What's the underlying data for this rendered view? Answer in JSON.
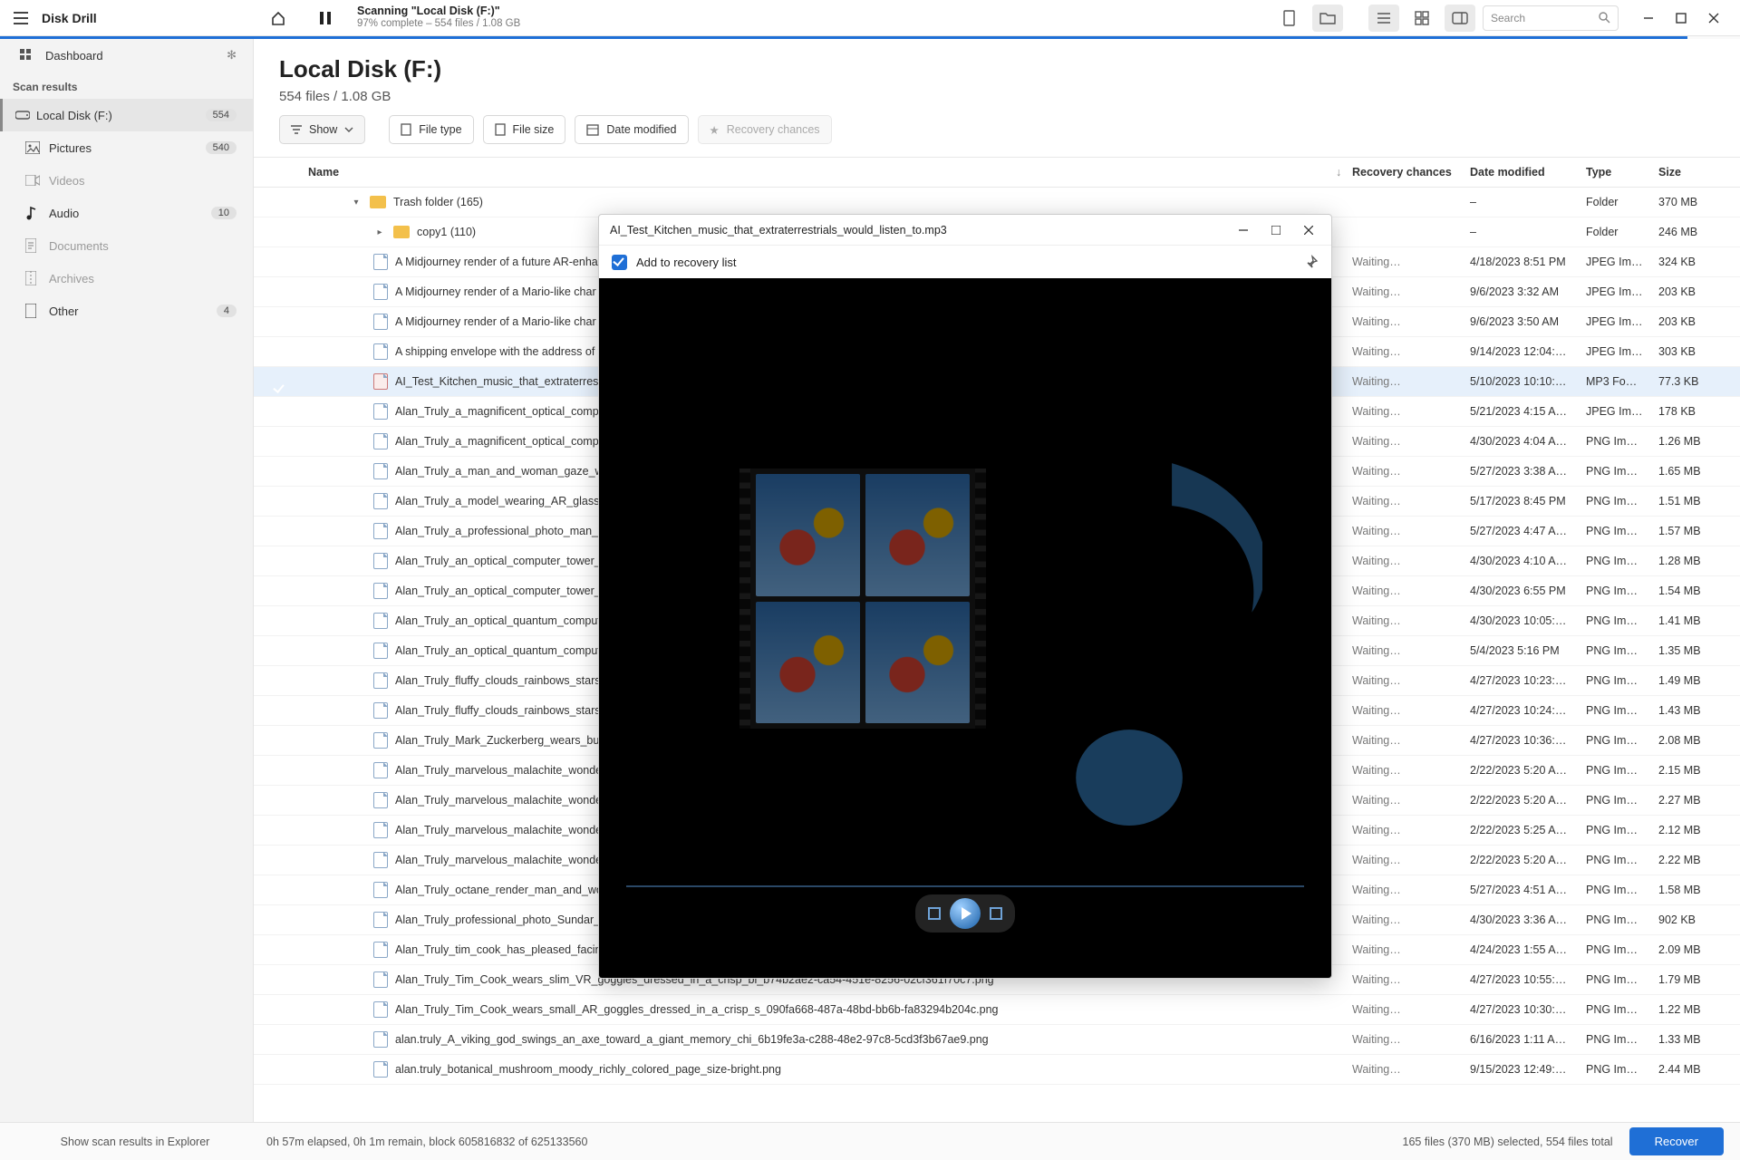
{
  "app": {
    "title": "Disk Drill"
  },
  "scan_status": {
    "line1": "Scanning \"Local Disk (F:)\"",
    "line2": "97% complete – 554 files / 1.08 GB",
    "progress_pct": 97
  },
  "search": {
    "placeholder": "Search"
  },
  "sidebar": {
    "dashboard": "Dashboard",
    "section": "Scan results",
    "items": [
      {
        "icon": "disk",
        "label": "Local Disk (F:)",
        "badge": "554",
        "active": true
      },
      {
        "icon": "picture",
        "label": "Pictures",
        "badge": "540",
        "indent": true
      },
      {
        "icon": "video",
        "label": "Videos",
        "disabled": true,
        "indent": true
      },
      {
        "icon": "audio",
        "label": "Audio",
        "badge": "10",
        "indent": true
      },
      {
        "icon": "doc",
        "label": "Documents",
        "disabled": true,
        "indent": true
      },
      {
        "icon": "archive",
        "label": "Archives",
        "disabled": true,
        "indent": true
      },
      {
        "icon": "other",
        "label": "Other",
        "badge": "4",
        "indent": true
      }
    ]
  },
  "header": {
    "title": "Local Disk (F:)",
    "subtitle": "554 files / 1.08 GB"
  },
  "toolbar": {
    "show": "Show",
    "filetype": "File type",
    "filesize": "File size",
    "datemod": "Date modified",
    "recchance": "Recovery chances"
  },
  "columns": {
    "name": "Name",
    "rec": "Recovery chances",
    "date": "Date modified",
    "type": "Type",
    "size": "Size"
  },
  "rows": [
    {
      "kind": "folder",
      "depth": 1,
      "exp": "▾",
      "name": "Trash folder (165)",
      "rec": "",
      "date": "–",
      "type": "Folder",
      "size": "370 MB"
    },
    {
      "kind": "folder",
      "depth": 2,
      "exp": "▸",
      "name": "copy1 (110)",
      "rec": "",
      "date": "–",
      "type": "Folder",
      "size": "246 MB"
    },
    {
      "kind": "file",
      "depth": 2,
      "name": "A Midjourney render of a future AR-enha",
      "rec": "Waiting…",
      "date": "4/18/2023 8:51 PM",
      "type": "JPEG Im…",
      "size": "324 KB"
    },
    {
      "kind": "file",
      "depth": 2,
      "name": "A Midjourney render of a Mario-like char",
      "rec": "Waiting…",
      "date": "9/6/2023 3:32 AM",
      "type": "JPEG Im…",
      "size": "203 KB"
    },
    {
      "kind": "file",
      "depth": 2,
      "name": "A Midjourney render of a Mario-like char",
      "rec": "Waiting…",
      "date": "9/6/2023 3:50 AM",
      "type": "JPEG Im…",
      "size": "203 KB"
    },
    {
      "kind": "file",
      "depth": 2,
      "name": "A shipping envelope with the address of t",
      "rec": "Waiting…",
      "date": "9/14/2023 12:04:…",
      "type": "JPEG Im…",
      "size": "303 KB"
    },
    {
      "kind": "audio",
      "depth": 2,
      "sel": true,
      "name": "AI_Test_Kitchen_music_that_extraterrestria",
      "rec": "Waiting…",
      "date": "5/10/2023 10:10:…",
      "type": "MP3 Fo…",
      "size": "77.3 KB"
    },
    {
      "kind": "file",
      "depth": 2,
      "name": "Alan_Truly_a_magnificent_optical_comput",
      "rec": "Waiting…",
      "date": "5/21/2023 4:15 A…",
      "type": "JPEG Im…",
      "size": "178 KB"
    },
    {
      "kind": "file",
      "depth": 2,
      "name": "Alan_Truly_a_magnificent_optical_comput",
      "rec": "Waiting…",
      "date": "4/30/2023 4:04 A…",
      "type": "PNG Im…",
      "size": "1.26 MB"
    },
    {
      "kind": "file",
      "depth": 2,
      "name": "Alan_Truly_a_man_and_woman_gaze_with",
      "rec": "Waiting…",
      "date": "5/27/2023 3:38 A…",
      "type": "PNG Im…",
      "size": "1.65 MB"
    },
    {
      "kind": "file",
      "depth": 2,
      "name": "Alan_Truly_a_model_wearing_AR_glasses_",
      "rec": "Waiting…",
      "date": "5/17/2023 8:45 PM",
      "type": "PNG Im…",
      "size": "1.51 MB"
    },
    {
      "kind": "file",
      "depth": 2,
      "name": "Alan_Truly_a_professional_photo_man_an",
      "rec": "Waiting…",
      "date": "5/27/2023 4:47 A…",
      "type": "PNG Im…",
      "size": "1.57 MB"
    },
    {
      "kind": "file",
      "depth": 2,
      "name": "Alan_Truly_an_optical_computer_tower_lig",
      "rec": "Waiting…",
      "date": "4/30/2023 4:10 A…",
      "type": "PNG Im…",
      "size": "1.28 MB"
    },
    {
      "kind": "file",
      "depth": 2,
      "name": "Alan_Truly_an_optical_computer_tower_lig",
      "rec": "Waiting…",
      "date": "4/30/2023 6:55 PM",
      "type": "PNG Im…",
      "size": "1.54 MB"
    },
    {
      "kind": "file",
      "depth": 2,
      "name": "Alan_Truly_an_optical_quantum_computer",
      "rec": "Waiting…",
      "date": "4/30/2023 10:05:…",
      "type": "PNG Im…",
      "size": "1.41 MB"
    },
    {
      "kind": "file",
      "depth": 2,
      "name": "Alan_Truly_an_optical_quantum_computer",
      "rec": "Waiting…",
      "date": "5/4/2023 5:16 PM",
      "type": "PNG Im…",
      "size": "1.35 MB"
    },
    {
      "kind": "file",
      "depth": 2,
      "name": "Alan_Truly_fluffy_clouds_rainbows_stars_m",
      "rec": "Waiting…",
      "date": "4/27/2023 10:23:…",
      "type": "PNG Im…",
      "size": "1.49 MB"
    },
    {
      "kind": "file",
      "depth": 2,
      "name": "Alan_Truly_fluffy_clouds_rainbows_stars_m",
      "rec": "Waiting…",
      "date": "4/27/2023 10:24:…",
      "type": "PNG Im…",
      "size": "1.43 MB"
    },
    {
      "kind": "file",
      "depth": 2,
      "name": "Alan_Truly_Mark_Zuckerberg_wears_bulky",
      "rec": "Waiting…",
      "date": "4/27/2023 10:36:…",
      "type": "PNG Im…",
      "size": "2.08 MB"
    },
    {
      "kind": "file",
      "depth": 2,
      "name": "Alan_Truly_marvelous_malachite_wonder_",
      "rec": "Waiting…",
      "date": "2/22/2023 5:20 A…",
      "type": "PNG Im…",
      "size": "2.15 MB"
    },
    {
      "kind": "file",
      "depth": 2,
      "name": "Alan_Truly_marvelous_malachite_wonder_",
      "rec": "Waiting…",
      "date": "2/22/2023 5:20 A…",
      "type": "PNG Im…",
      "size": "2.27 MB"
    },
    {
      "kind": "file",
      "depth": 2,
      "name": "Alan_Truly_marvelous_malachite_wonder_",
      "rec": "Waiting…",
      "date": "2/22/2023 5:25 A…",
      "type": "PNG Im…",
      "size": "2.12 MB"
    },
    {
      "kind": "file",
      "depth": 2,
      "name": "Alan_Truly_marvelous_malachite_wonder_",
      "rec": "Waiting…",
      "date": "2/22/2023 5:20 A…",
      "type": "PNG Im…",
      "size": "2.22 MB"
    },
    {
      "kind": "file",
      "depth": 2,
      "name": "Alan_Truly_octane_render_man_and_wom",
      "rec": "Waiting…",
      "date": "5/27/2023 4:51 A…",
      "type": "PNG Im…",
      "size": "1.58 MB"
    },
    {
      "kind": "file",
      "depth": 2,
      "name": "Alan_Truly_professional_photo_Sundar_Pi",
      "rec": "Waiting…",
      "date": "4/30/2023 3:36 A…",
      "type": "PNG Im…",
      "size": "902 KB"
    },
    {
      "kind": "file",
      "depth": 2,
      "name": "Alan_Truly_tim_cook_has_pleased_facing_the_camera_a_colorful_an_c436f530-bd90-4182-adc5-2bbc70156e94.png",
      "rec": "Waiting…",
      "date": "4/24/2023 1:55 A…",
      "type": "PNG Im…",
      "size": "2.09 MB"
    },
    {
      "kind": "file",
      "depth": 2,
      "name": "Alan_Truly_Tim_Cook_wears_slim_VR_goggles_dressed_in_a_crisp_bl_b74b2ae2-ca54-451e-8256-02cf361f70c7.png",
      "rec": "Waiting…",
      "date": "4/27/2023 10:55:…",
      "type": "PNG Im…",
      "size": "1.79 MB"
    },
    {
      "kind": "file",
      "depth": 2,
      "name": "Alan_Truly_Tim_Cook_wears_small_AR_goggles_dressed_in_a_crisp_s_090fa668-487a-48bd-bb6b-fa83294b204c.png",
      "rec": "Waiting…",
      "date": "4/27/2023 10:30:…",
      "type": "PNG Im…",
      "size": "1.22 MB"
    },
    {
      "kind": "file",
      "depth": 2,
      "name": "alan.truly_A_viking_god_swings_an_axe_toward_a_giant_memory_chi_6b19fe3a-c288-48e2-97c8-5cd3f3b67ae9.png",
      "rec": "Waiting…",
      "date": "6/16/2023 1:11 A…",
      "type": "PNG Im…",
      "size": "1.33 MB"
    },
    {
      "kind": "file",
      "depth": 2,
      "name": "alan.truly_botanical_mushroom_moody_richly_colored_page_size-bright.png",
      "rec": "Waiting…",
      "date": "9/15/2023 12:49:…",
      "type": "PNG Im…",
      "size": "2.44 MB"
    }
  ],
  "preview": {
    "title": "AI_Test_Kitchen_music_that_extraterrestrials_would_listen_to.mp3",
    "add_label": "Add to recovery list"
  },
  "footer": {
    "explorer": "Show scan results in Explorer",
    "elapsed": "0h 57m elapsed, 0h 1m remain, block 605816832 of 625133560",
    "selection": "165 files (370 MB) selected, 554 files total",
    "recover": "Recover"
  }
}
